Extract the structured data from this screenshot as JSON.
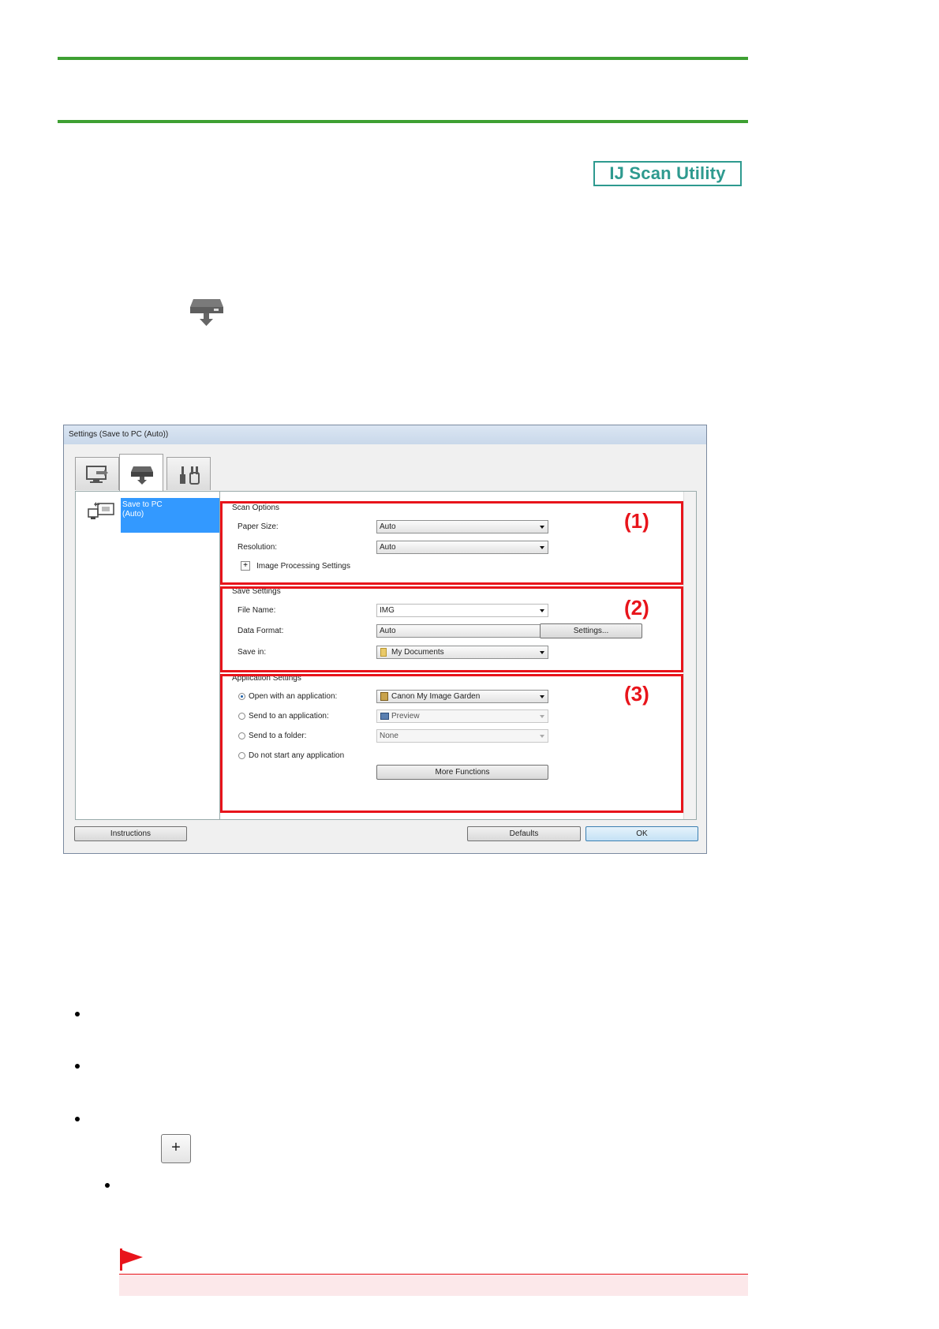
{
  "header": {
    "badge": "IJ Scan Utility"
  },
  "dialog": {
    "title": "Settings (Save to PC (Auto))",
    "tabs": [
      "scan-from-computer-icon",
      "scan-from-operation-panel-icon",
      "general-settings-icon"
    ],
    "sidebar": {
      "selected_item": "Save to PC\n(Auto)",
      "selected_item_line1": "Save to PC",
      "selected_item_line2": "(Auto)"
    },
    "scan_options": {
      "heading": "Scan Options",
      "paper_size_label": "Paper Size:",
      "paper_size_value": "Auto",
      "resolution_label": "Resolution:",
      "resolution_value": "Auto",
      "image_processing_label": "Image Processing Settings"
    },
    "save_settings": {
      "heading": "Save Settings",
      "file_name_label": "File Name:",
      "file_name_value": "IMG",
      "data_format_label": "Data Format:",
      "data_format_value": "Auto",
      "settings_button": "Settings...",
      "save_in_label": "Save in:",
      "save_in_value": "My Documents"
    },
    "application_settings": {
      "heading": "Application Settings",
      "open_with_label": "Open with an application:",
      "open_with_value": "Canon My Image Garden",
      "send_to_app_label": "Send to an application:",
      "send_to_app_value": "Preview",
      "send_to_folder_label": "Send to a folder:",
      "send_to_folder_value": "None",
      "do_not_start_label": "Do not start any application",
      "more_functions_button": "More Functions",
      "selected_option": "Open with an application:"
    },
    "callouts": [
      "(1)",
      "(2)",
      "(3)"
    ],
    "footer": {
      "instructions_button": "Instructions",
      "defaults_button": "Defaults",
      "ok_button": "OK"
    }
  },
  "colors": {
    "rule_green": "#3ea032",
    "badge_teal": "#2e9a8f",
    "callout_red": "#e8141b",
    "selection_blue": "#3399ff",
    "important_bg": "#fce8ea"
  }
}
